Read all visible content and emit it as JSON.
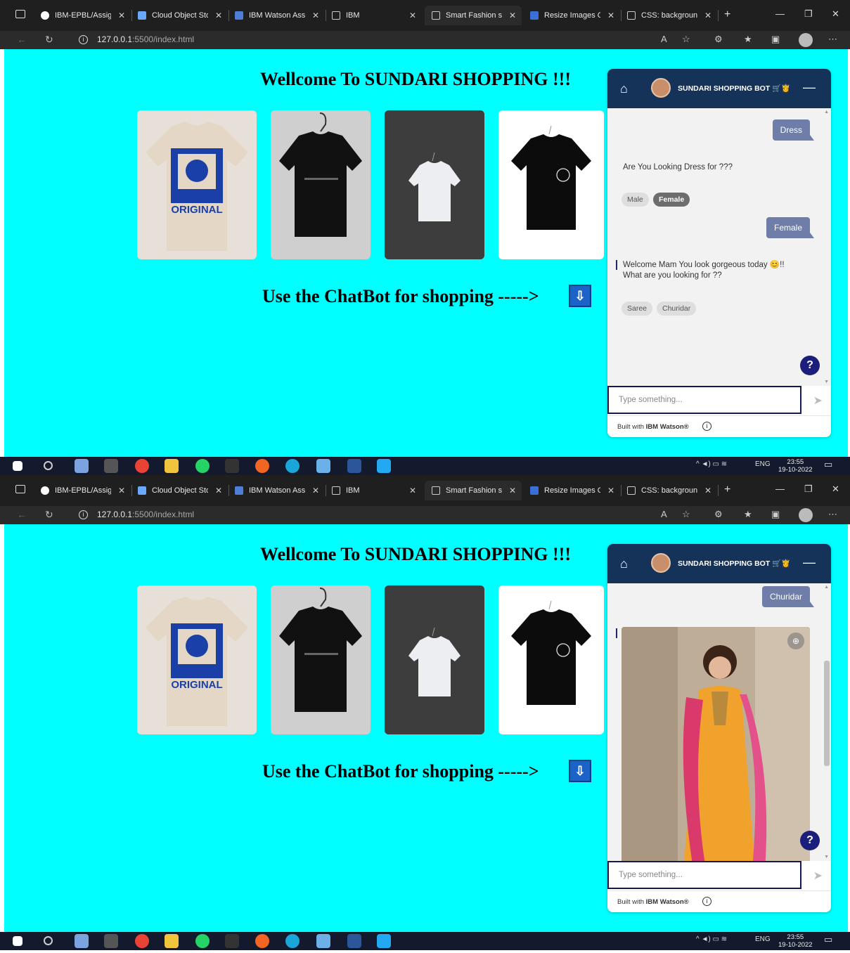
{
  "browser": {
    "tabs": [
      {
        "title": "IBM-EPBL/Assign",
        "favicon": "github-icon"
      },
      {
        "title": "Cloud Object Sto",
        "favicon": "cloud-icon"
      },
      {
        "title": "IBM Watson Assis",
        "favicon": "watson-icon"
      },
      {
        "title": "IBM",
        "favicon": "page-icon"
      },
      {
        "title": "Smart Fashion sh",
        "favicon": "page-icon",
        "active": true
      },
      {
        "title": "Resize Images Or",
        "favicon": "image-icon"
      },
      {
        "title": "CSS: background",
        "favicon": "page-icon"
      }
    ],
    "url_host": "127.0.0.1",
    "url_rest": ":5500/index.html"
  },
  "page": {
    "heading": "Wellcome To SUNDARI SHOPPING !!!",
    "cta": "Use the ChatBot for shopping ----->",
    "background": "#00ffff",
    "products": [
      {
        "name": "tshirt-original",
        "caption": "ORIGINAL"
      },
      {
        "name": "tshirt-black-hanging"
      },
      {
        "name": "tshirt-white-dark-bg"
      },
      {
        "name": "tshirt-black-logo"
      }
    ]
  },
  "chat": {
    "bot_name": "SUNDARI SHOPPING BOT 🛒👸",
    "input_placeholder": "Type something...",
    "footer_prefix": "Built with ",
    "footer_brand": "IBM Watson®",
    "help": "?",
    "screen1": {
      "user_msg_1": "Dress",
      "bot_msg_1": "Are You Looking Dress for ???",
      "chips_1": [
        "Male",
        "Female"
      ],
      "selected_chip_1": "Female",
      "user_msg_2": "Female",
      "bot_msg_2_line1": "Welcome Mam You look gorgeous today 😊!!",
      "bot_msg_2_line2": "What are you looking for ??",
      "chips_2": [
        "Saree",
        "Churidar"
      ]
    },
    "screen2": {
      "user_msg_1": "Churidar",
      "image_alt": "churidar dress image"
    }
  },
  "taskbar": {
    "lang": "ENG",
    "time": "23:55",
    "date": "19-10-2022"
  }
}
